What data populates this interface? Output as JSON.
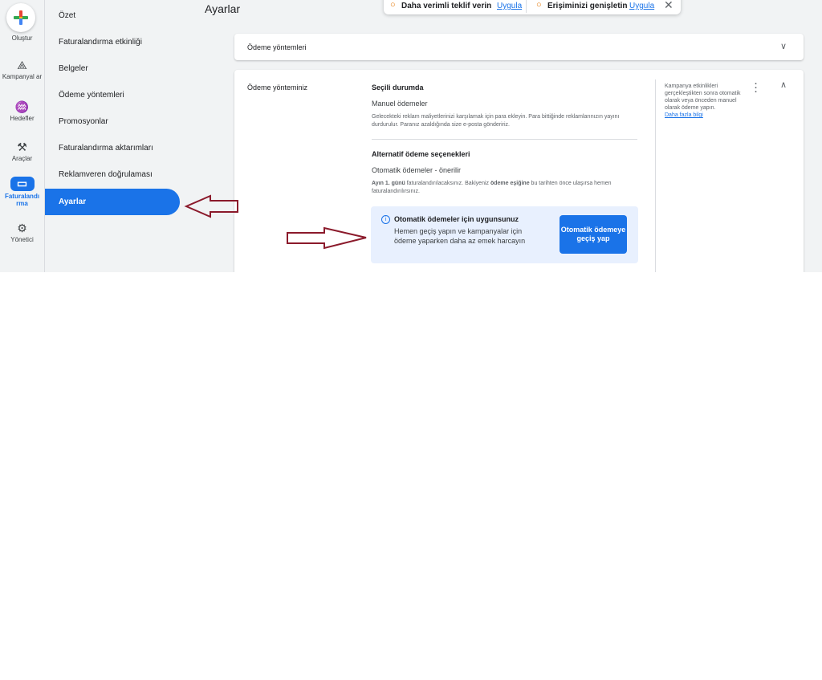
{
  "rail": {
    "create": "Oluştur",
    "items": [
      {
        "label": "Kampanyal ar",
        "icon": "megaphone-icon"
      },
      {
        "label": "Hedefler",
        "icon": "trophy-icon"
      },
      {
        "label": "Araçlar",
        "icon": "tools-icon"
      },
      {
        "label": "Faturalandı rma",
        "icon": "credit-card-icon"
      },
      {
        "label": "Yönetici",
        "icon": "gear-icon"
      }
    ]
  },
  "sidebar": {
    "items": [
      "Özet",
      "Faturalandırma etkinliği",
      "Belgeler",
      "Ödeme yöntemleri",
      "Promosyonlar",
      "Faturalandırma aktarımları",
      "Reklamveren doğrulaması"
    ],
    "active": "Ayarlar"
  },
  "page_title": "Ayarlar",
  "notification": {
    "tip1": "Daha verimli teklif verin",
    "tip2": "Erişiminizi genişletin",
    "apply": "Uygula"
  },
  "payment_methods_card": {
    "title": "Ödeme yöntemleri"
  },
  "payment_card": {
    "label": "Ödeme yönteminiz",
    "current_heading": "Seçili durumda",
    "current_value": "Manuel ödemeler",
    "current_desc": "Gelecekteki reklam maliyetlerinizi karşılamak için para ekleyin. Para bittiğinde reklamlarınızın yayını durdurulur. Paranız azaldığında size e-posta göndeririz.",
    "alt_heading": "Alternatif ödeme seçenekleri",
    "alt_value": "Otomatik ödemeler - önerilir",
    "alt_desc_bold1": "Ayın 1. günü",
    "alt_desc_1": " faturalandırılacaksınız. Bakiyeniz ",
    "alt_desc_bold2": "ödeme eşiğine",
    "alt_desc_2": " bu tarihten önce ulaşırsa hemen faturalandırılırsınız.",
    "callout_heading": "Otomatik ödemeler için uygunsunuz",
    "callout_body": "Hemen geçiş yapın ve kampanyalar için ödeme yaparken daha az emek harcayın",
    "cta": "Otomatik ödemeye geçiş yap",
    "side_note": "Kampanya etkinlikleri gerçekleştikten sonra otomatik olarak veya önceden manuel olarak ödeme yapın.",
    "learn_more": "Daha fazla bilgi"
  },
  "colors": {
    "accent": "#1a73e8",
    "annotation_arrow": "#8b1a2b"
  }
}
